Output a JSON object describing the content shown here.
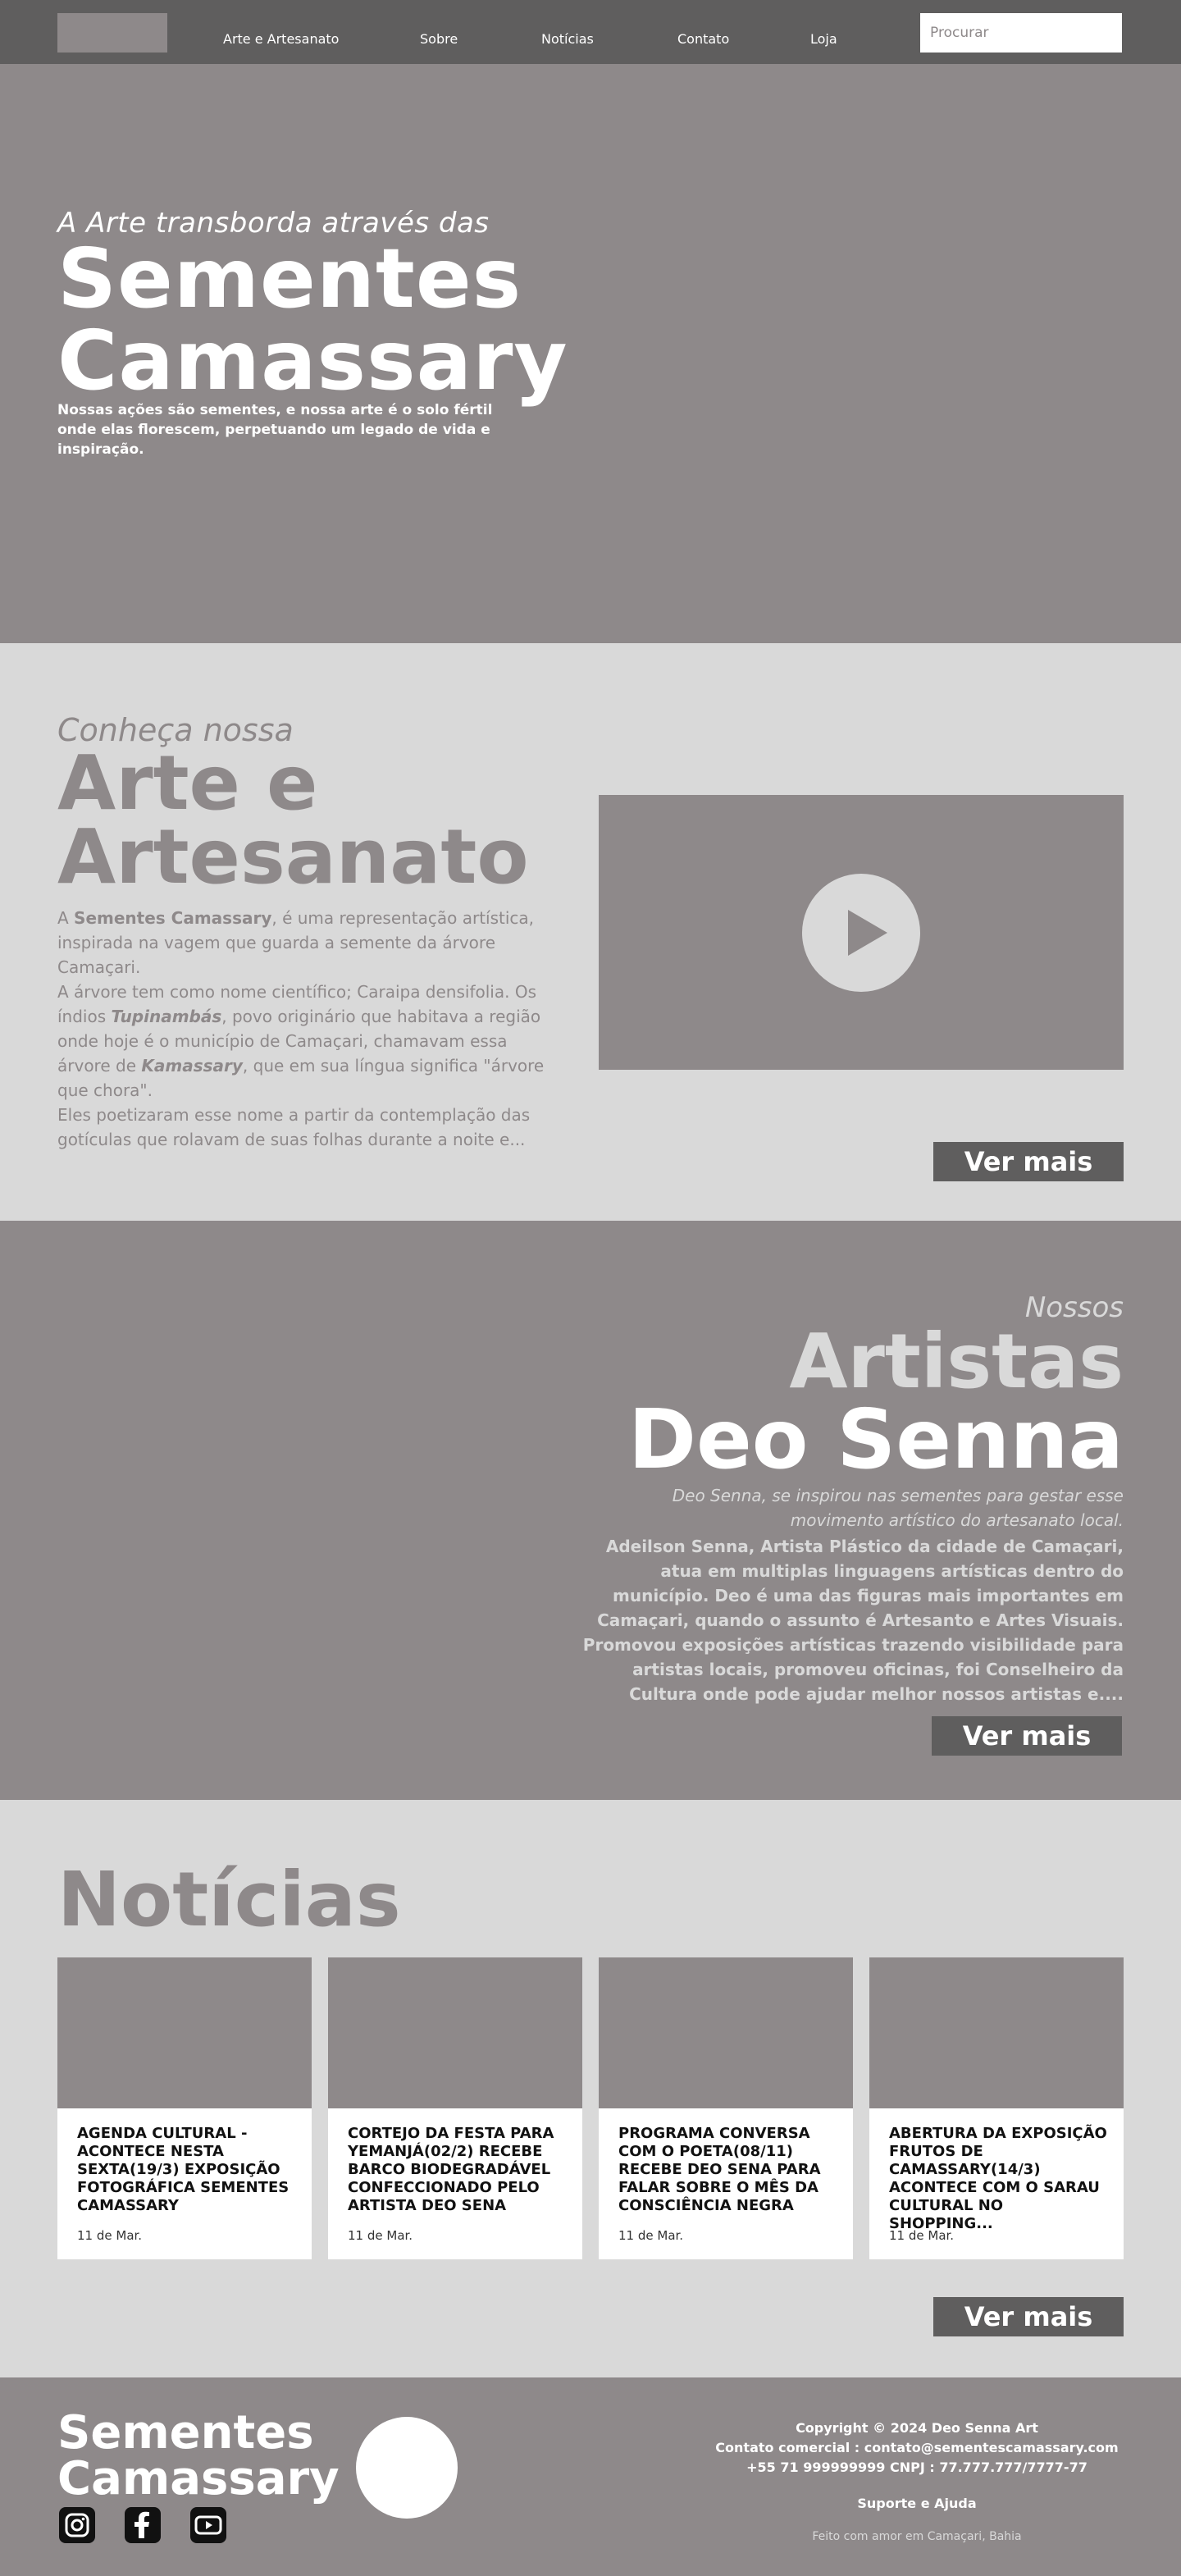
{
  "nav": {
    "links": [
      "Arte e Artesanato",
      "Sobre",
      "Notícias",
      "Contato",
      "Loja"
    ],
    "search_placeholder": "Procurar"
  },
  "hero": {
    "pre": "A Arte transborda através das",
    "title_line1": "Sementes",
    "title_line2": "Camassary",
    "description": "Nossas ações são sementes, e nossa arte é o solo fértil onde elas florescem, perpetuando um legado de vida e inspiração."
  },
  "arte": {
    "pre": "Conheça nossa",
    "title_line1": "Arte e",
    "title_line2": "Artesanato",
    "p1_prefix": "A ",
    "p1_bold": "Sementes Camassary",
    "p1_rest": ", é uma representação artística, inspirada na vagem que guarda a semente da árvore Camaçari.",
    "p2_a": "A árvore tem como nome científico; Caraipa densifolia. Os índios ",
    "p2_bold1": "Tupinambás",
    "p2_b": ", povo originário que habitava a região onde hoje é o município de Camaçari, chamavam essa árvore de ",
    "p2_bold2": "Kamassary",
    "p2_c": ", que em sua língua significa \"árvore que chora\".",
    "p3": "Eles poetizaram esse nome a partir da contemplação das gotículas que rolavam de suas folhas durante a noite e...",
    "button": "Ver mais"
  },
  "artistas": {
    "pre": "Nossos",
    "title": "Artistas",
    "name": "Deo Senna",
    "quote": "Deo Senna, se inspirou nas sementes para gestar esse movimento artístico do artesanato local.",
    "bio": "Adeilson Senna, Artista Plástico da cidade de Camaçari, atua em multiplas linguagens artísticas dentro do município. Deo é uma das figuras mais importantes em Camaçari, quando o assunto é Artesanto e Artes Visuais. Promovou exposições artísticas trazendo visibilidade para artistas locais, promoveu oficinas, foi Conselheiro da Cultura onde pode ajudar melhor nossos artistas e....",
    "button": "Ver mais"
  },
  "noticias": {
    "title": "Notícias",
    "cards": [
      {
        "title": "AGENDA CULTURAL - ACONTECE NESTA SEXTA(19/3) EXPOSIÇÃO FOTOGRÁFICA SEMENTES CAMASSARY",
        "date": "11 de Mar."
      },
      {
        "title": "CORTEJO DA FESTA PARA YEMANJÁ(02/2) RECEBE BARCO BIODEGRADÁVEL CONFECCIONADO PELO ARTISTA DEO SENA",
        "date": "11 de Mar."
      },
      {
        "title": "PROGRAMA CONVERSA COM O POETA(08/11) RECEBE  DEO SENA PARA FALAR SOBRE O MÊS DA CONSCIÊNCIA NEGRA",
        "date": "11 de Mar."
      },
      {
        "title": "ABERTURA DA EXPOSIÇÃO FRUTOS DE CAMASSARY(14/3) ACONTECE COM O SARAU CULTURAL NO SHOPPING...",
        "date": "11 de Mar."
      }
    ],
    "button": "Ver mais"
  },
  "footer": {
    "title_line1": "Sementes",
    "title_line2": "Camassary",
    "copyright": "Copyright © 2024 Deo Senna Art",
    "contact": "Contato comercial : contato@sementescamassary.com",
    "phone": "+55 71 999999999 CNPJ : 77.777.777/7777-77",
    "support": "Suporte e Ajuda",
    "made": "Feito com amor em Camaçari, Bahia",
    "social_icons": [
      "instagram-icon",
      "facebook-icon",
      "youtube-icon"
    ]
  },
  "colors": {
    "nav": "#5f5e5e",
    "primary_gray": "#8e898a",
    "light_gray": "#d9d9d9",
    "button": "#5f5e5e"
  }
}
